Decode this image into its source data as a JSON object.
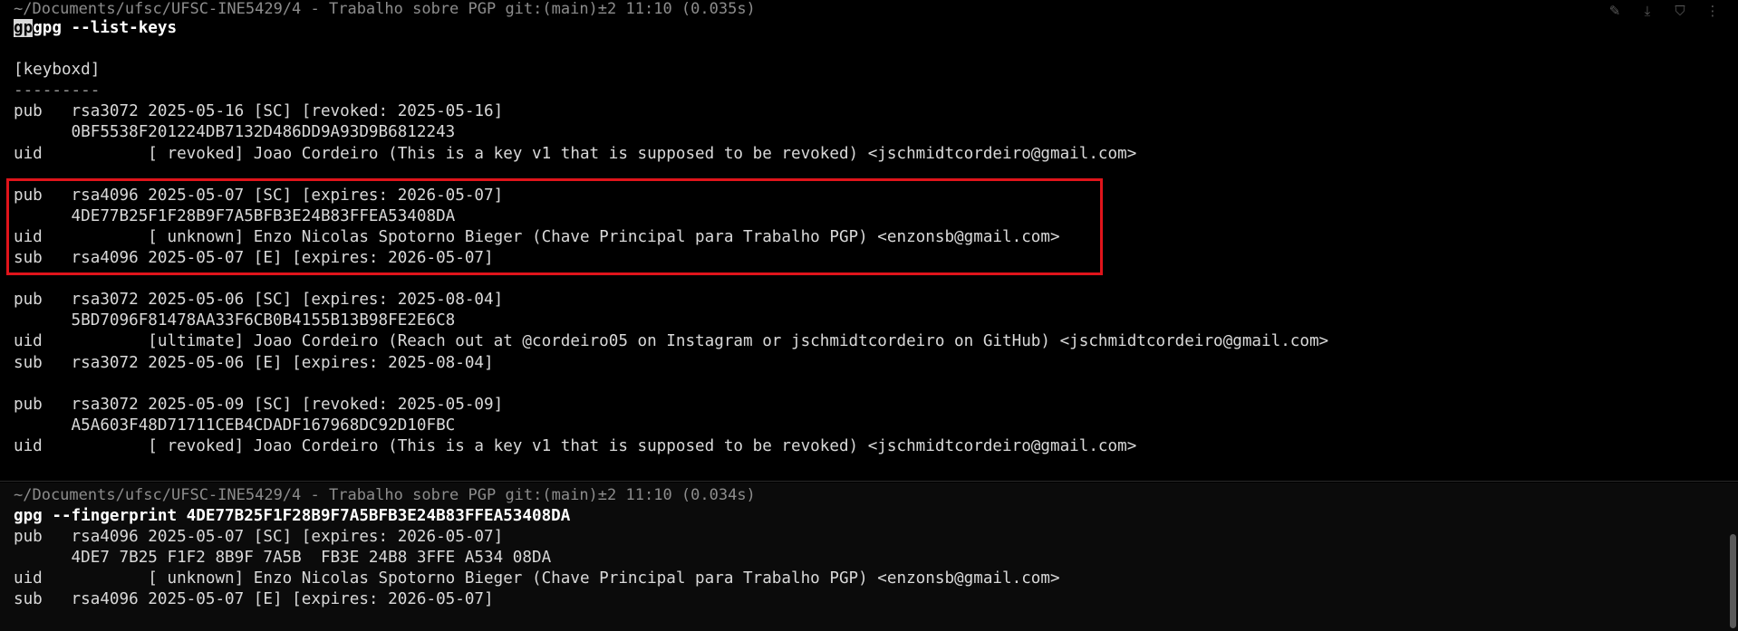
{
  "toolbar": {
    "icons": [
      "pin-icon",
      "download-icon",
      "filter-icon",
      "more-icon"
    ],
    "glyphs": [
      "✎",
      "⤓",
      "⛉",
      "⋮"
    ]
  },
  "block1": {
    "prompt": "~/Documents/ufsc/UFSC-INE5429/4 - Trabalho sobre PGP git:(main)±2 11:10 (0.035s)",
    "cursor_text": "gp",
    "command": "gpg --list-keys",
    "lines": [
      "",
      "[keyboxd]",
      "---------",
      "pub   rsa3072 2025-05-16 [SC] [revoked: 2025-05-16]",
      "      0BF5538F201224DB7132D486DD9A93D9B6812243",
      "uid           [ revoked] Joao Cordeiro (This is a key v1 that is supposed to be revoked) <jschmidtcordeiro@gmail.com>",
      "",
      "pub   rsa4096 2025-05-07 [SC] [expires: 2026-05-07]",
      "      4DE77B25F1F28B9F7A5BFB3E24B83FFEA53408DA",
      "uid           [ unknown] Enzo Nicolas Spotorno Bieger (Chave Principal para Trabalho PGP) <enzonsb@gmail.com>",
      "sub   rsa4096 2025-05-07 [E] [expires: 2026-05-07]",
      "",
      "pub   rsa3072 2025-05-06 [SC] [expires: 2025-08-04]",
      "      5BD7096F81478AA33F6CB0B4155B13B98FE2E6C8",
      "uid           [ultimate] Joao Cordeiro (Reach out at @cordeiro05 on Instagram or jschmidtcordeiro on GitHub) <jschmidtcordeiro@gmail.com>",
      "sub   rsa3072 2025-05-06 [E] [expires: 2025-08-04]",
      "",
      "pub   rsa3072 2025-05-09 [SC] [revoked: 2025-05-09]",
      "      A5A603F48D71711CEB4CDADF167968DC92D10FBC",
      "uid           [ revoked] Joao Cordeiro (This is a key v1 that is supposed to be revoked) <jschmidtcordeiro@gmail.com>"
    ]
  },
  "block2": {
    "prompt": "~/Documents/ufsc/UFSC-INE5429/4 - Trabalho sobre PGP git:(main)±2 11:10 (0.034s)",
    "command": "gpg --fingerprint 4DE77B25F1F28B9F7A5BFB3E24B83FFEA53408DA",
    "lines": [
      "pub   rsa4096 2025-05-07 [SC] [expires: 2026-05-07]",
      "      4DE7 7B25 F1F2 8B9F 7A5B  FB3E 24B8 3FFE A534 08DA",
      "uid           [ unknown] Enzo Nicolas Spotorno Bieger (Chave Principal para Trabalho PGP) <enzonsb@gmail.com>",
      "sub   rsa4096 2025-05-07 [E] [expires: 2026-05-07]"
    ]
  }
}
